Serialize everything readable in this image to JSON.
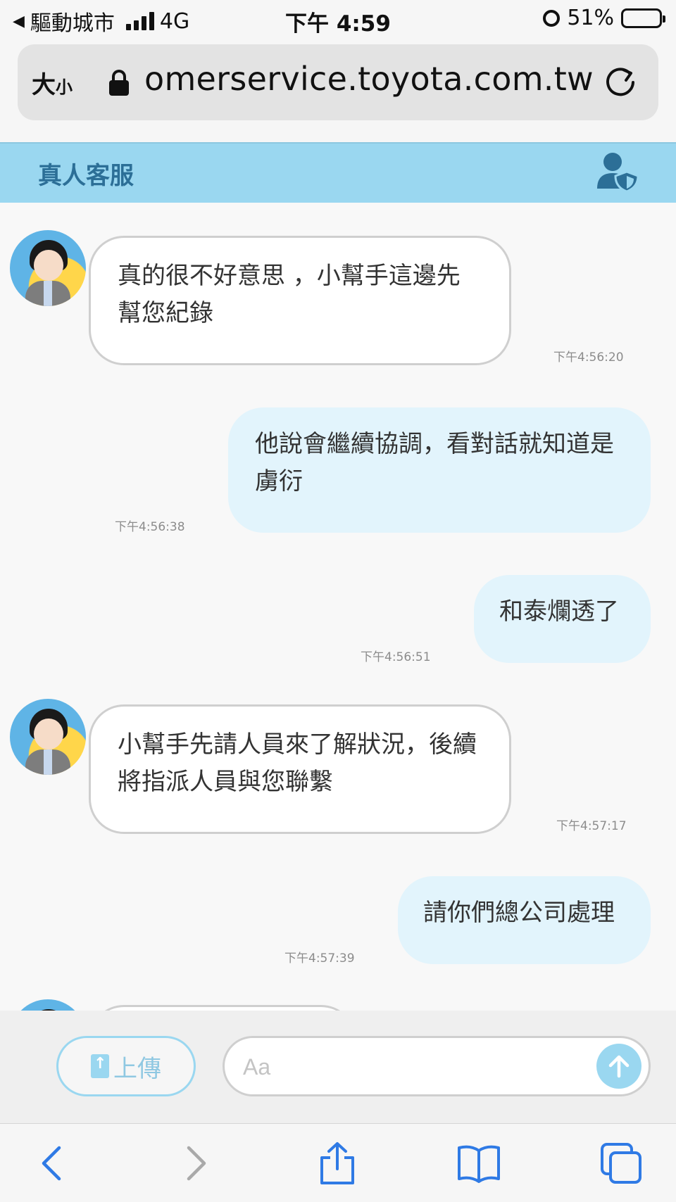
{
  "status_bar": {
    "back_app": "驅動城市",
    "network": "4G",
    "time": "下午 4:59",
    "battery_percent": "51%",
    "battery_level": 0.51
  },
  "url_bar": {
    "text_size_label": "大",
    "text_size_small": "小",
    "url": "omerservice.toyota.com.tw"
  },
  "header": {
    "title": "真人客服",
    "accent_color": "#9ad7f0"
  },
  "messages": [
    {
      "sender": "bot",
      "text": "真的很不好意思 ，小幫手這邊先幫您紀錄",
      "time": "下午4:56:20"
    },
    {
      "sender": "user",
      "text": "他說會繼續協調，看對話就知道是虜衍",
      "time": "下午4:56:38"
    },
    {
      "sender": "user",
      "text": "和泰爛透了",
      "time": "下午4:56:51"
    },
    {
      "sender": "bot",
      "text": "小幫手先請人員來了解狀況，後續將指派人員與您聯繫",
      "time": "下午4:57:17"
    },
    {
      "sender": "user",
      "text": "請你們總公司處理",
      "time": "下午4:57:39"
    }
  ],
  "composer": {
    "upload_label": "上傳",
    "placeholder": "Aa"
  },
  "icons": {
    "back": "chevron-left-icon",
    "forward": "chevron-right-icon",
    "share": "share-icon",
    "bookmarks": "book-icon",
    "tabs": "tabs-icon",
    "reload": "reload-icon",
    "lock": "lock-icon",
    "agent": "user-shield-icon",
    "send": "arrow-up-icon"
  }
}
